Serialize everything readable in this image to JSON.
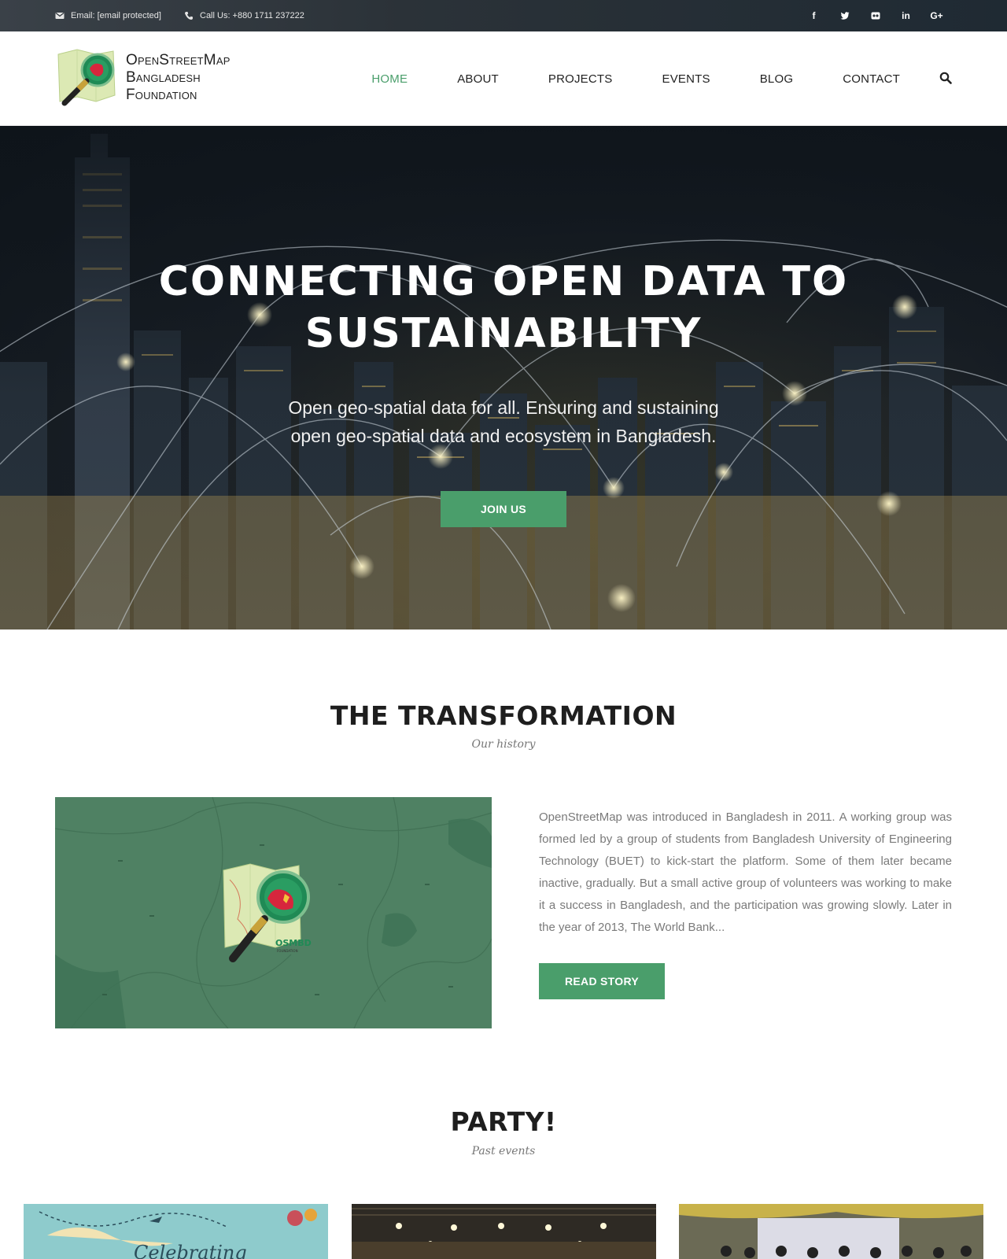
{
  "topbar": {
    "email": "Email: [email protected]",
    "phone": "Call Us: +880 1711 237222",
    "social": [
      {
        "name": "facebook-icon",
        "glyph": "f"
      },
      {
        "name": "twitter-icon",
        "glyph": "t"
      },
      {
        "name": "flickr-icon",
        "glyph": "••"
      },
      {
        "name": "linkedin-icon",
        "glyph": "in"
      },
      {
        "name": "google-plus-icon",
        "glyph": "G+"
      }
    ]
  },
  "logo": {
    "line1": "OpenStreetMap",
    "line2": "Bangladesh",
    "line3": "Foundation"
  },
  "nav": {
    "items": [
      "HOME",
      "ABOUT",
      "PROJECTS",
      "EVENTS",
      "BLOG",
      "CONTACT"
    ],
    "active": "HOME"
  },
  "hero": {
    "title_line1": "CONNECTING OPEN DATA TO",
    "title_line2": "SUSTAINABILITY",
    "subtitle_line1": "Open geo-spatial data for all. Ensuring and sustaining",
    "subtitle_line2": "open geo-spatial data and ecosystem in Bangladesh.",
    "button": "JOIN US"
  },
  "transformation": {
    "title": "THE TRANSFORMATION",
    "subtitle": "Our history",
    "map_logo_text": "OSMBD",
    "map_logo_sub": "FOUNDATION",
    "body": "OpenStreetMap was introduced in Bangladesh in 2011. A working group was formed led by a group of students from Bangladesh University of Engineering Technology (BUET) to kick-start the platform. Some of them later became inactive, gradually. But a small active group of volunteers was working to make it a success in Bangladesh, and the participation was growing slowly. Later in the year of 2013, The World Bank...",
    "button": "READ STORY"
  },
  "events": {
    "title": "PARTY!",
    "subtitle": "Past events",
    "card1_text": "Celebrating"
  },
  "colors": {
    "accent": "#4a9e6b",
    "topbar": "#2b3238",
    "map_green": "#4f8163"
  }
}
